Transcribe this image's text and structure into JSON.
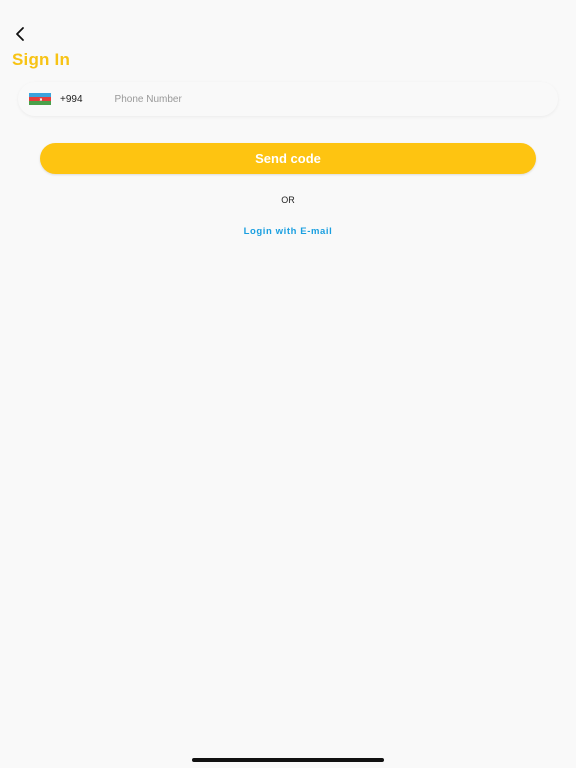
{
  "header": {
    "back_icon": "chevron-left-icon",
    "title": "Sign In"
  },
  "phone": {
    "flag_icon": "azerbaijan-flag-icon",
    "country_code": "+994",
    "placeholder": "Phone Number"
  },
  "actions": {
    "send_code_label": "Send code",
    "or_label": "OR",
    "email_login_label": "Login with E-mail"
  },
  "colors": {
    "title": "#f7c315",
    "button": "#fec411",
    "link": "#1a9fe0",
    "background": "#f9f9f9",
    "flag_blue": "#3aa3dd",
    "flag_red": "#e53d3d",
    "flag_green": "#4aa04a"
  }
}
